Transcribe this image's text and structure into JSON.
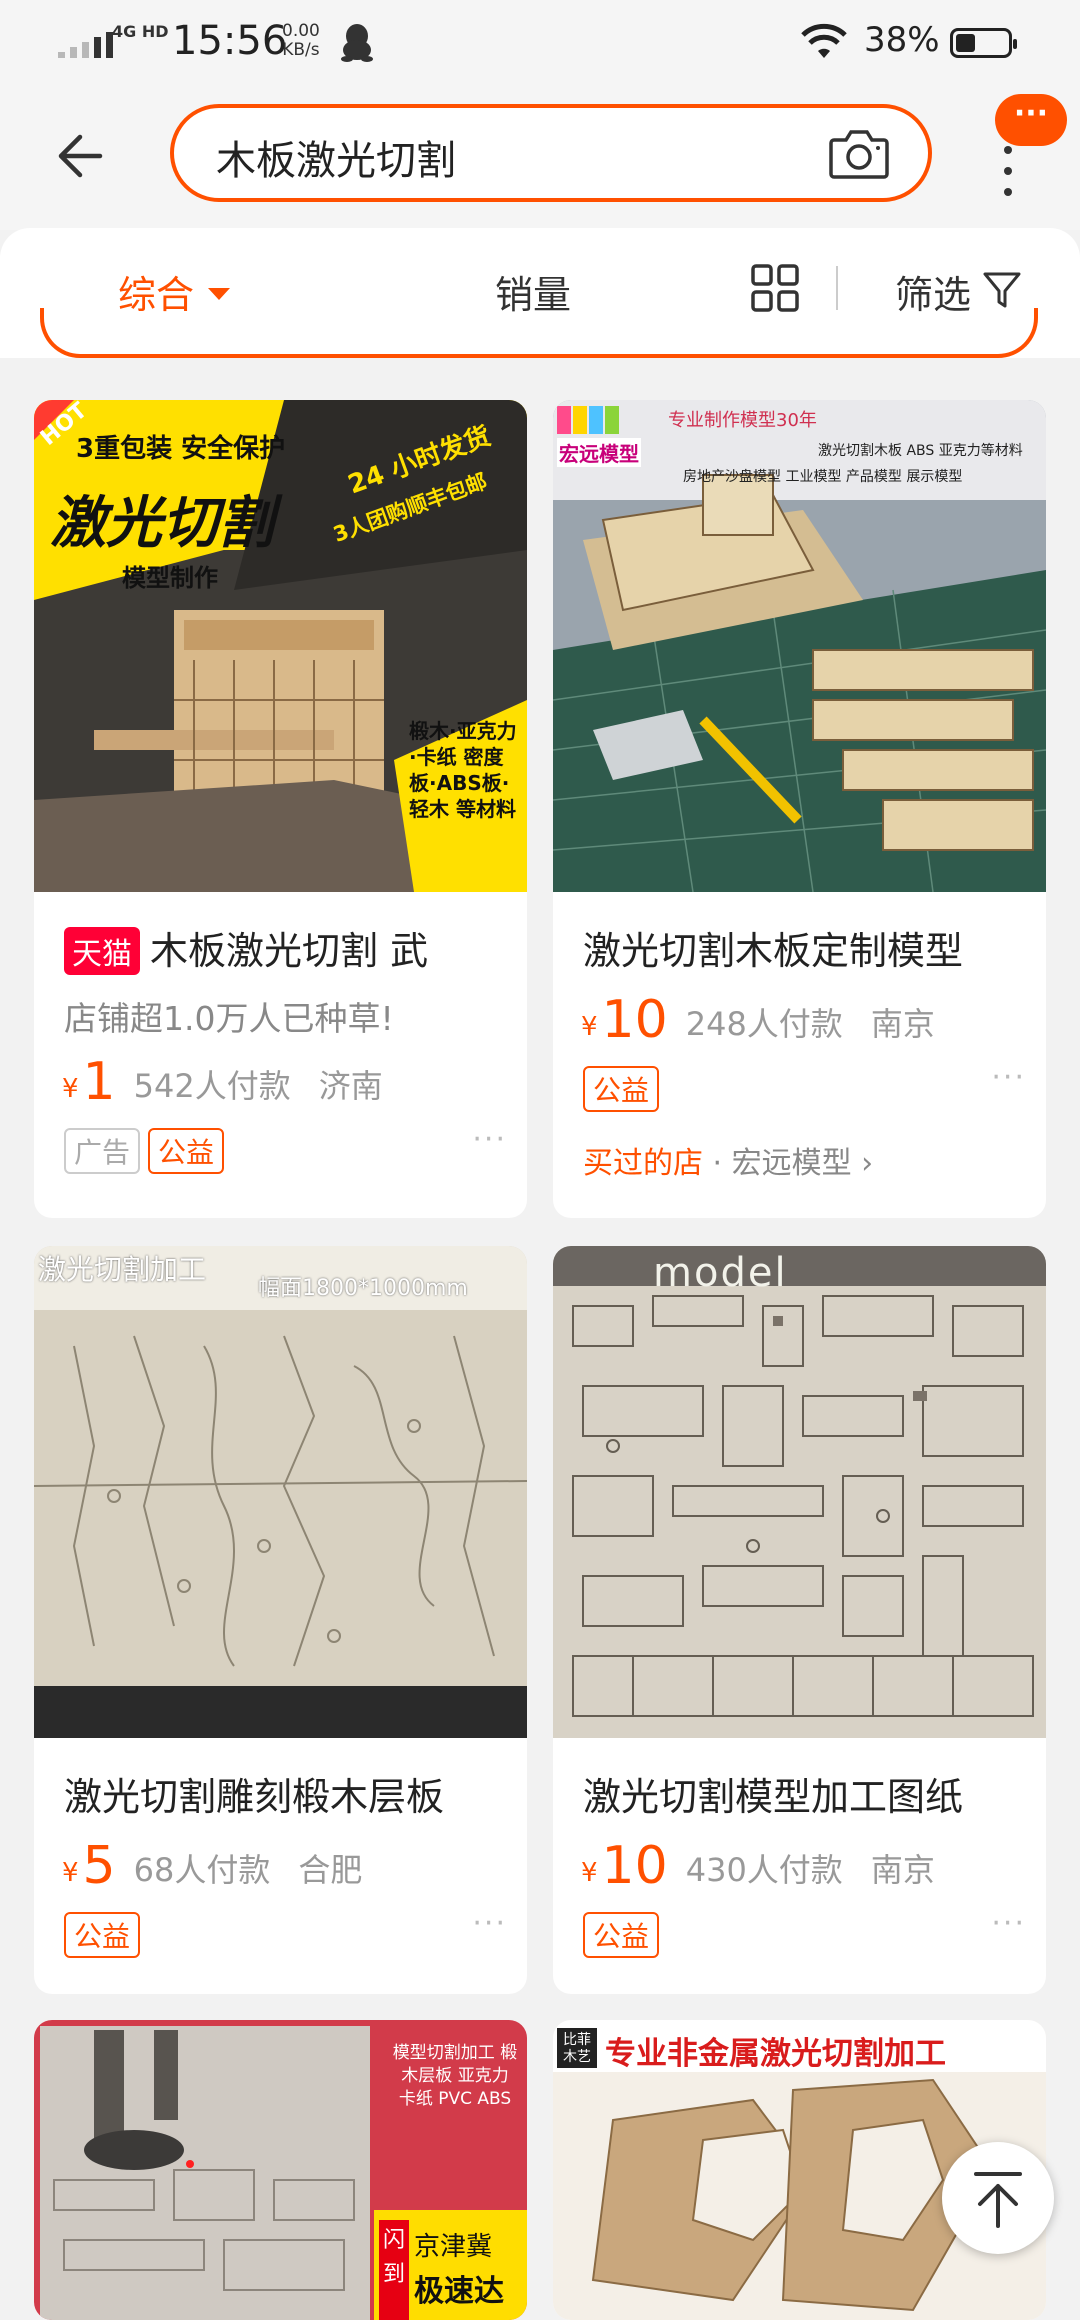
{
  "status_bar": {
    "network": "4G HD",
    "time": "15:56",
    "speed_value": "0.00",
    "speed_unit": "KB/s",
    "battery_percent": "38%",
    "battery_level": 0.38
  },
  "header": {
    "search_query": "木板激光切割",
    "more_label": "···"
  },
  "filter_bar": {
    "tab_overall": "综合",
    "tab_sales": "销量",
    "tab_filter": "筛选"
  },
  "products": [
    {
      "badge": "天猫",
      "title": "木板激光切割 武",
      "subtitle": "店铺超1.0万人已种草!",
      "currency": "¥",
      "price": "1",
      "buyers": "542人付款",
      "location": "济南",
      "tags": [
        "广告",
        "公益"
      ],
      "image_text": {
        "hot": "HOT",
        "banner": "3重包装 安全保护",
        "headline": "激光切割",
        "sub": "模型制作",
        "ship_time": "24 小时发货",
        "ship_note": "3人团购顺丰包邮",
        "materials": "椴木·亚克力·卡纸 密度板·ABS板·轻木 等材料"
      }
    },
    {
      "title": "激光切割木板定制模型",
      "currency": "¥",
      "price": "10",
      "buyers": "248人付款",
      "location": "南京",
      "tags": [
        "公益"
      ],
      "bought_label": "买过的店",
      "shop_name": "宏远模型",
      "image_text": {
        "logo": "宏远模型",
        "top_line": "专业制作模型30年",
        "line1": "激光切割木板 ABS 亚克力等材料",
        "line2": "房地产沙盘模型   工业模型 产品模型 展示模型"
      }
    },
    {
      "title": "激光切割雕刻椴木层板",
      "currency": "¥",
      "price": "5",
      "buyers": "68人付款",
      "location": "合肥",
      "tags": [
        "公益"
      ],
      "image_text": {
        "label": "激光切割加工",
        "size": "幅面1800*1000mm"
      }
    },
    {
      "title": "激光切割模型加工图纸",
      "currency": "¥",
      "price": "10",
      "buyers": "430人付款",
      "location": "南京",
      "tags": [
        "公益"
      ],
      "image_text": {
        "watermark": "model"
      }
    },
    {
      "image_text": {
        "side_list": "模型切割加工 椴木层板 亚克力 卡纸 PVC ABS",
        "flash": "闪到",
        "region": "京津冀",
        "speed": "极速达"
      }
    },
    {
      "image_text": {
        "logo": "比菲木艺",
        "headline": "专业非金属激光切割加工"
      }
    }
  ],
  "colors": {
    "accent": "#ff5000",
    "tmall": "#ff0036",
    "background": "#f2f2f2"
  },
  "icons": [
    "back-arrow-icon",
    "camera-icon",
    "grid-view-icon",
    "funnel-icon",
    "back-to-top-icon"
  ]
}
